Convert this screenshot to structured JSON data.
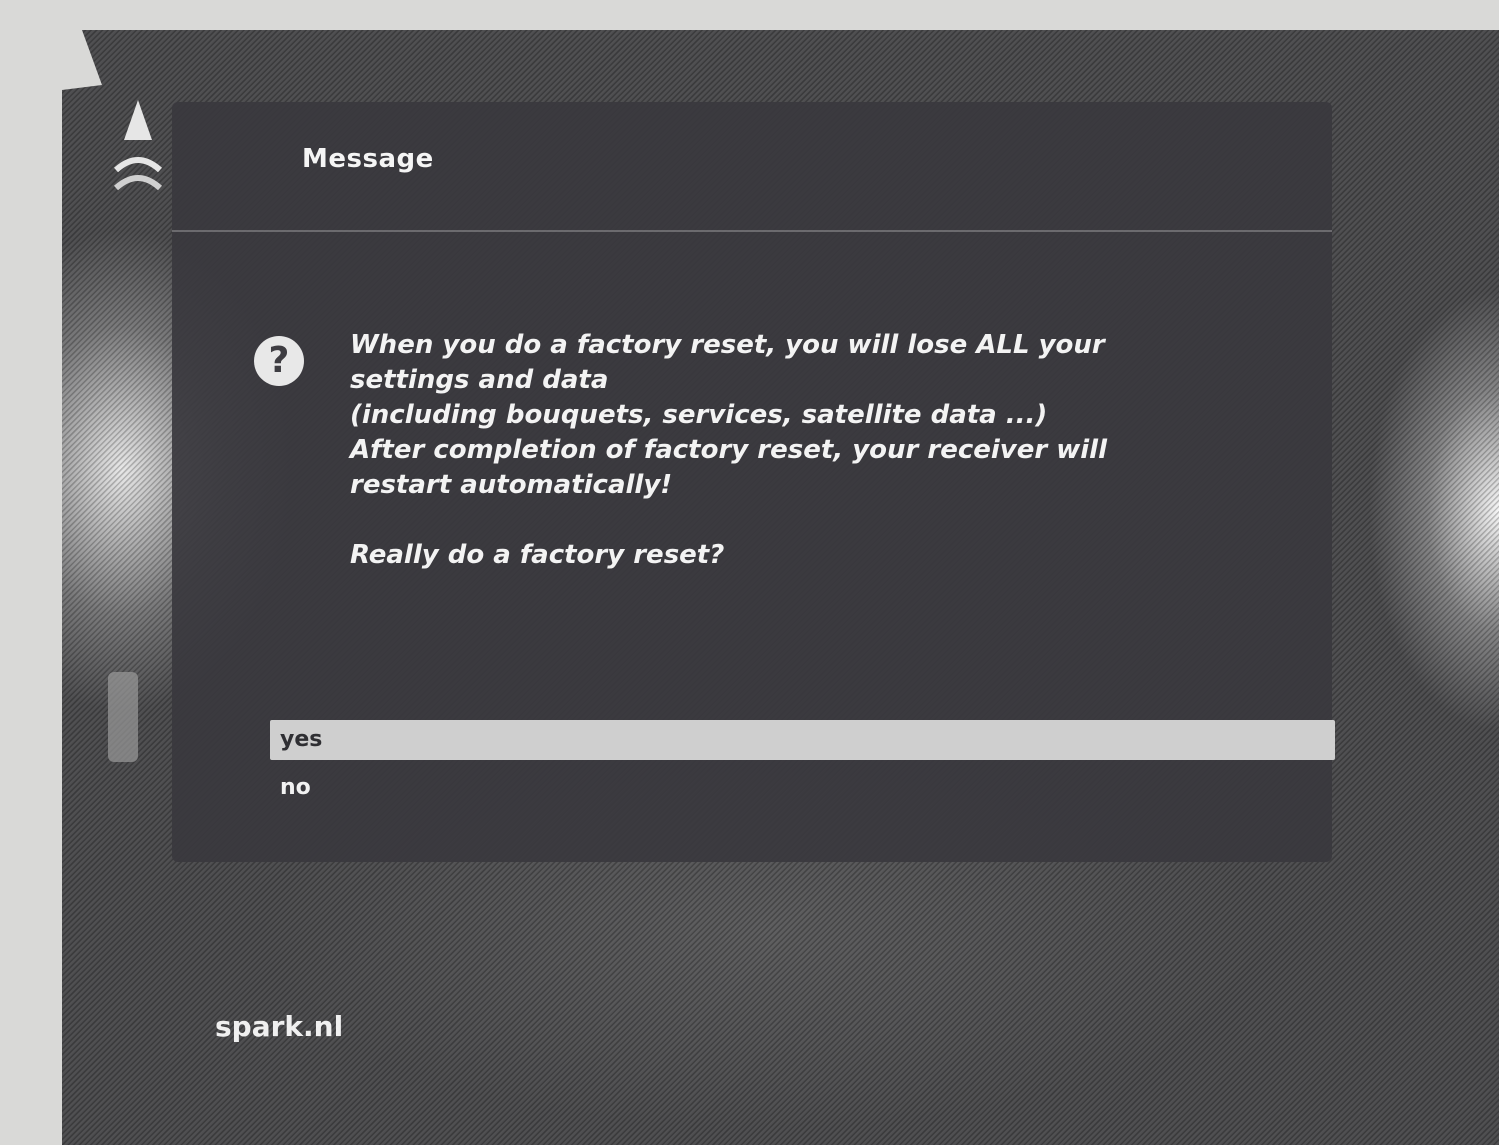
{
  "dialog": {
    "title": "Message",
    "icon": "question-icon",
    "message_lines": [
      "When you do a factory reset, you will lose ALL your",
      "settings and data",
      "(including bouquets, services, satellite data ...)",
      "After completion of factory reset, your receiver will",
      "restart automatically!"
    ],
    "question": "Really do a factory reset?",
    "options": [
      {
        "label": "yes",
        "selected": true
      },
      {
        "label": "no",
        "selected": false
      }
    ]
  },
  "footer": {
    "label": "spark.nl"
  },
  "colors": {
    "dialog_background": "#3a383e",
    "selection_bar": "#cfcfcf",
    "text": "#f2f2f2"
  }
}
